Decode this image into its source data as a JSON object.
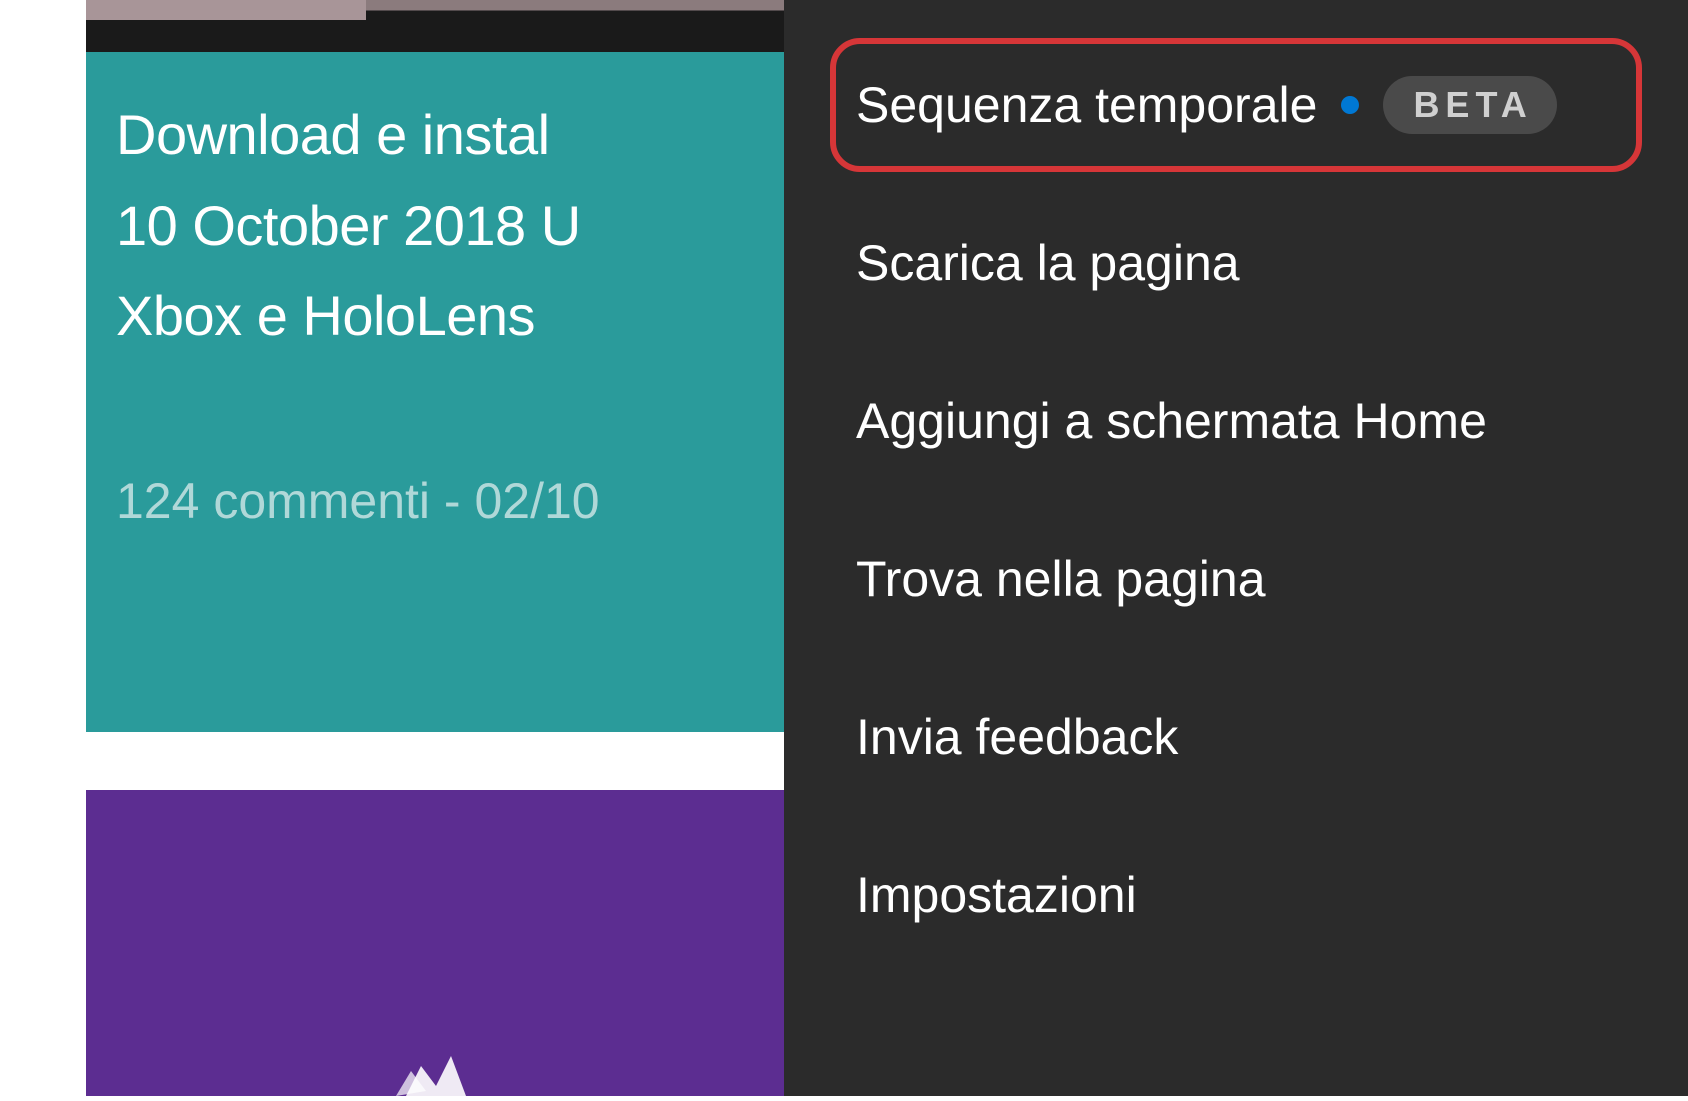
{
  "article": {
    "title_line1": "Download e instal",
    "title_line2": "10 October 2018 U",
    "title_line3": "Xbox e HoloLens",
    "meta": "124 commenti - 02/10"
  },
  "menu": {
    "items": [
      {
        "label": "Sequenza temporale",
        "has_dot": true,
        "badge": "BETA",
        "highlighted": true
      },
      {
        "label": "Scarica la pagina"
      },
      {
        "label": "Aggiungi a schermata Home"
      },
      {
        "label": "Trova nella pagina"
      },
      {
        "label": "Invia feedback"
      },
      {
        "label": "Impostazioni"
      }
    ]
  }
}
